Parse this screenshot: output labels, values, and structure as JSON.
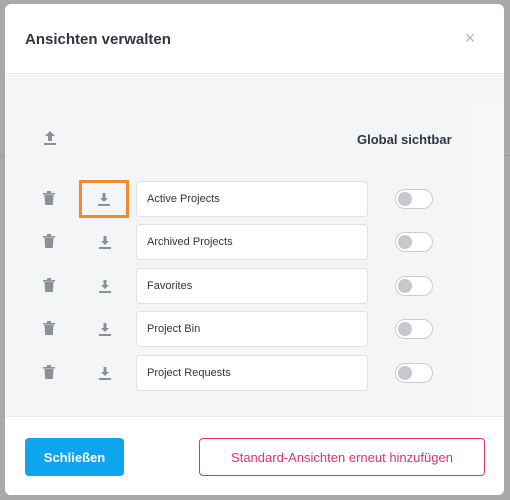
{
  "modal": {
    "title": "Ansichten verwalten",
    "close_icon": "close-icon"
  },
  "body": {
    "column_title": "Global sichtbar",
    "rows": [
      {
        "name": "Active Projects",
        "global_visible": false,
        "highlighted": true
      },
      {
        "name": "Archived Projects",
        "global_visible": false
      },
      {
        "name": "Favorites",
        "global_visible": false
      },
      {
        "name": "Project Bin",
        "global_visible": false
      },
      {
        "name": "Project Requests",
        "global_visible": false
      }
    ]
  },
  "footer": {
    "close_label": "Schließen",
    "reset_label": "Standard-Ansichten erneut hinzufügen"
  },
  "colors": {
    "primary": "#0ea5ef",
    "danger": "#e0336e",
    "highlight": "#f08c2e"
  }
}
